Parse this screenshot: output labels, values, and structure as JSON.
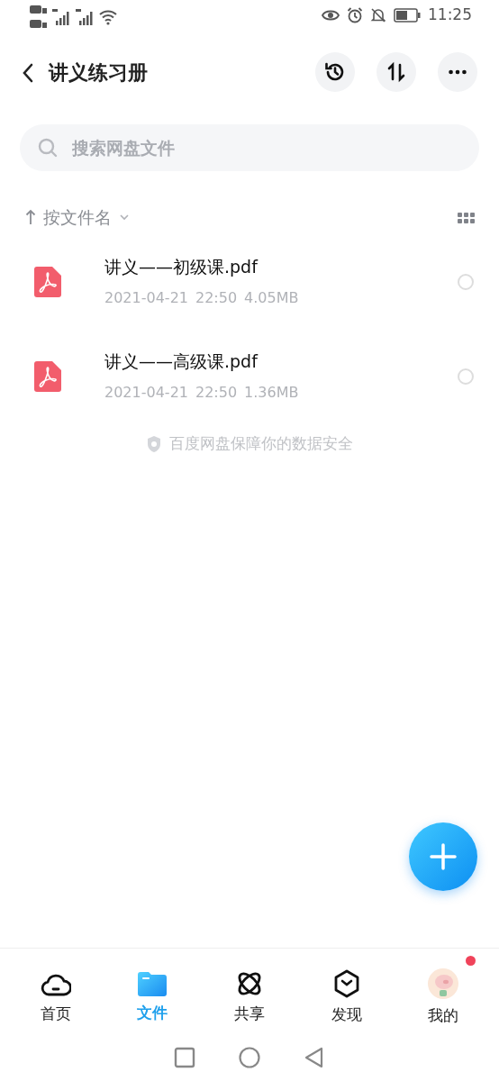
{
  "status_bar": {
    "time": "11:25"
  },
  "header": {
    "title": "讲义练习册"
  },
  "search": {
    "placeholder": "搜索网盘文件"
  },
  "sort": {
    "label": "按文件名"
  },
  "files": [
    {
      "name": "讲义——初级课.pdf",
      "date": "2021-04-21",
      "time": "22:50",
      "size": "4.05MB",
      "selected": false
    },
    {
      "name": "讲义——高级课.pdf",
      "date": "2021-04-21",
      "time": "22:50",
      "size": "1.36MB",
      "selected": false
    }
  ],
  "notice": "百度网盘保障你的数据安全",
  "bottom_nav": [
    {
      "label": "首页",
      "selected": false,
      "badge": false
    },
    {
      "label": "文件",
      "selected": true,
      "badge": false
    },
    {
      "label": "共享",
      "selected": false,
      "badge": false
    },
    {
      "label": "发现",
      "selected": false,
      "badge": false
    },
    {
      "label": "我的",
      "selected": false,
      "badge": true
    }
  ]
}
